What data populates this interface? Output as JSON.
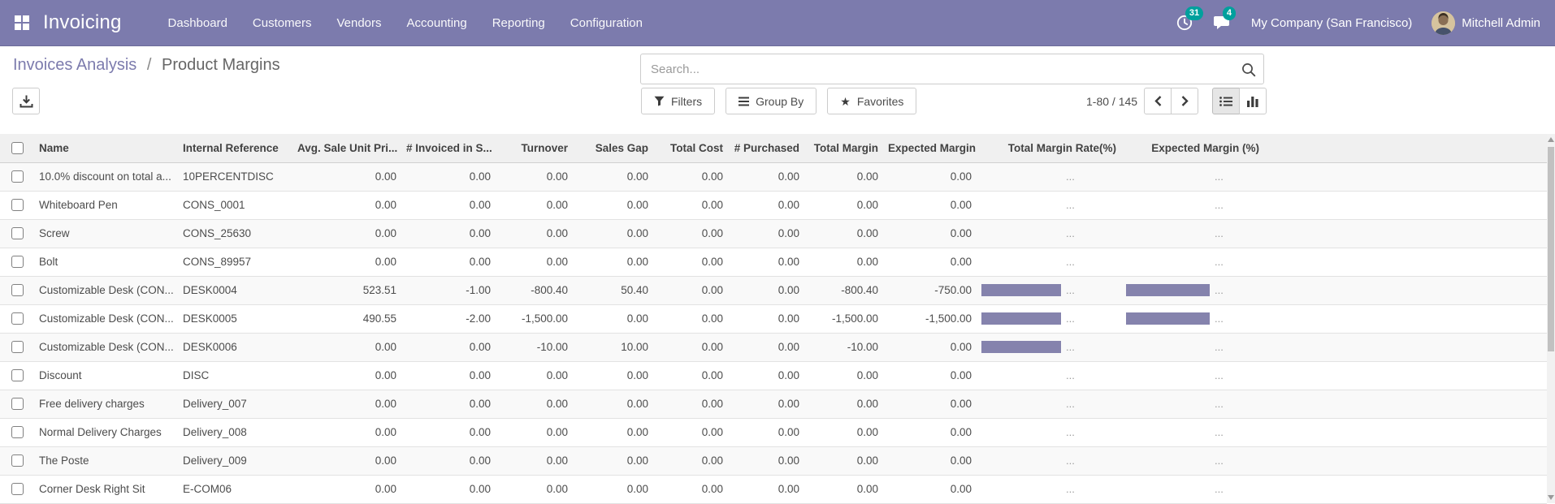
{
  "colors": {
    "navbar_bg": "#7c7bad",
    "badge_bg": "#00a09d",
    "link": "#7c7bad",
    "bar_fill": "#8583ad",
    "text_dark": "#4c4c4c"
  },
  "nav": {
    "app_name": "Invoicing",
    "menu_items": [
      "Dashboard",
      "Customers",
      "Vendors",
      "Accounting",
      "Reporting",
      "Configuration"
    ],
    "activity_badge": "31",
    "messages_badge": "4",
    "company": "My Company (San Francisco)",
    "user": "Mitchell Admin"
  },
  "breadcrumb": {
    "parent": "Invoices Analysis",
    "separator": "/",
    "current": "Product Margins"
  },
  "search": {
    "placeholder": "Search..."
  },
  "toolbar": {
    "filters": "Filters",
    "group_by": "Group By",
    "favorites": "Favorites"
  },
  "pager": {
    "range": "1-80",
    "separator": "/",
    "total": "145"
  },
  "view_switcher": {
    "active": "list",
    "views": [
      "list",
      "graph"
    ]
  },
  "icons": {
    "apps": "2x2-grid",
    "activities": "clock",
    "messages": "chat-bubble",
    "export": "download-arrow",
    "filters": "funnel",
    "group_by": "three-lines",
    "favorites": "★",
    "search": "magnifier",
    "pager_prev": "chevron-left",
    "pager_next": "chevron-right",
    "view_list": "bulleted-list",
    "view_graph": "bar-chart"
  },
  "table": {
    "select_all_checked": false,
    "bar_placeholder": "...",
    "columns": [
      {
        "key": "select",
        "label": ""
      },
      {
        "key": "name",
        "label": "Name"
      },
      {
        "key": "internal_reference",
        "label": "Internal Reference"
      },
      {
        "key": "avg_sale_unit_price",
        "label": "Avg. Sale Unit Pri..."
      },
      {
        "key": "invoiced_in_sale",
        "label": "# Invoiced in S..."
      },
      {
        "key": "turnover",
        "label": "Turnover"
      },
      {
        "key": "sales_gap",
        "label": "Sales Gap"
      },
      {
        "key": "total_cost",
        "label": "Total Cost"
      },
      {
        "key": "purchased",
        "label": "# Purchased"
      },
      {
        "key": "total_margin",
        "label": "Total Margin"
      },
      {
        "key": "expected_margin",
        "label": "Expected Margin"
      },
      {
        "key": "total_margin_rate",
        "label": "Total Margin Rate(%)"
      },
      {
        "key": "expected_margin_pct",
        "label": "Expected Margin (%)"
      }
    ],
    "rows": [
      {
        "selected": false,
        "name": "10.0% discount on total a...",
        "internal_reference": "10PERCENTDISC",
        "avg_sale_unit_price": "0.00",
        "invoiced_in_sale": "0.00",
        "turnover": "0.00",
        "sales_gap": "0.00",
        "total_cost": "0.00",
        "purchased": "0.00",
        "total_margin": "0.00",
        "expected_margin": "0.00",
        "total_margin_rate_bar": 0,
        "expected_margin_pct_bar": 0
      },
      {
        "selected": false,
        "name": "Whiteboard Pen",
        "internal_reference": "CONS_0001",
        "avg_sale_unit_price": "0.00",
        "invoiced_in_sale": "0.00",
        "turnover": "0.00",
        "sales_gap": "0.00",
        "total_cost": "0.00",
        "purchased": "0.00",
        "total_margin": "0.00",
        "expected_margin": "0.00",
        "total_margin_rate_bar": 0,
        "expected_margin_pct_bar": 0
      },
      {
        "selected": false,
        "name": "Screw",
        "internal_reference": "CONS_25630",
        "avg_sale_unit_price": "0.00",
        "invoiced_in_sale": "0.00",
        "turnover": "0.00",
        "sales_gap": "0.00",
        "total_cost": "0.00",
        "purchased": "0.00",
        "total_margin": "0.00",
        "expected_margin": "0.00",
        "total_margin_rate_bar": 0,
        "expected_margin_pct_bar": 0
      },
      {
        "selected": false,
        "name": "Bolt",
        "internal_reference": "CONS_89957",
        "avg_sale_unit_price": "0.00",
        "invoiced_in_sale": "0.00",
        "turnover": "0.00",
        "sales_gap": "0.00",
        "total_cost": "0.00",
        "purchased": "0.00",
        "total_margin": "0.00",
        "expected_margin": "0.00",
        "total_margin_rate_bar": 0,
        "expected_margin_pct_bar": 0
      },
      {
        "selected": false,
        "name": "Customizable Desk (CON...",
        "internal_reference": "DESK0004",
        "avg_sale_unit_price": "523.51",
        "invoiced_in_sale": "-1.00",
        "turnover": "-800.40",
        "sales_gap": "50.40",
        "total_cost": "0.00",
        "purchased": "0.00",
        "total_margin": "-800.40",
        "expected_margin": "-750.00",
        "total_margin_rate_bar": 100,
        "expected_margin_pct_bar": 100
      },
      {
        "selected": false,
        "name": "Customizable Desk (CON...",
        "internal_reference": "DESK0005",
        "avg_sale_unit_price": "490.55",
        "invoiced_in_sale": "-2.00",
        "turnover": "-1,500.00",
        "sales_gap": "0.00",
        "total_cost": "0.00",
        "purchased": "0.00",
        "total_margin": "-1,500.00",
        "expected_margin": "-1,500.00",
        "total_margin_rate_bar": 100,
        "expected_margin_pct_bar": 100
      },
      {
        "selected": false,
        "name": "Customizable Desk (CON...",
        "internal_reference": "DESK0006",
        "avg_sale_unit_price": "0.00",
        "invoiced_in_sale": "0.00",
        "turnover": "-10.00",
        "sales_gap": "10.00",
        "total_cost": "0.00",
        "purchased": "0.00",
        "total_margin": "-10.00",
        "expected_margin": "0.00",
        "total_margin_rate_bar": 100,
        "expected_margin_pct_bar": 0
      },
      {
        "selected": false,
        "name": "Discount",
        "internal_reference": "DISC",
        "avg_sale_unit_price": "0.00",
        "invoiced_in_sale": "0.00",
        "turnover": "0.00",
        "sales_gap": "0.00",
        "total_cost": "0.00",
        "purchased": "0.00",
        "total_margin": "0.00",
        "expected_margin": "0.00",
        "total_margin_rate_bar": 0,
        "expected_margin_pct_bar": 0
      },
      {
        "selected": false,
        "name": "Free delivery charges",
        "internal_reference": "Delivery_007",
        "avg_sale_unit_price": "0.00",
        "invoiced_in_sale": "0.00",
        "turnover": "0.00",
        "sales_gap": "0.00",
        "total_cost": "0.00",
        "purchased": "0.00",
        "total_margin": "0.00",
        "expected_margin": "0.00",
        "total_margin_rate_bar": 0,
        "expected_margin_pct_bar": 0
      },
      {
        "selected": false,
        "name": "Normal Delivery Charges",
        "internal_reference": "Delivery_008",
        "avg_sale_unit_price": "0.00",
        "invoiced_in_sale": "0.00",
        "turnover": "0.00",
        "sales_gap": "0.00",
        "total_cost": "0.00",
        "purchased": "0.00",
        "total_margin": "0.00",
        "expected_margin": "0.00",
        "total_margin_rate_bar": 0,
        "expected_margin_pct_bar": 0
      },
      {
        "selected": false,
        "name": "The Poste",
        "internal_reference": "Delivery_009",
        "avg_sale_unit_price": "0.00",
        "invoiced_in_sale": "0.00",
        "turnover": "0.00",
        "sales_gap": "0.00",
        "total_cost": "0.00",
        "purchased": "0.00",
        "total_margin": "0.00",
        "expected_margin": "0.00",
        "total_margin_rate_bar": 0,
        "expected_margin_pct_bar": 0
      },
      {
        "selected": false,
        "name": "Corner Desk Right Sit",
        "internal_reference": "E-COM06",
        "avg_sale_unit_price": "0.00",
        "invoiced_in_sale": "0.00",
        "turnover": "0.00",
        "sales_gap": "0.00",
        "total_cost": "0.00",
        "purchased": "0.00",
        "total_margin": "0.00",
        "expected_margin": "0.00",
        "total_margin_rate_bar": 0,
        "expected_margin_pct_bar": 0
      }
    ]
  }
}
